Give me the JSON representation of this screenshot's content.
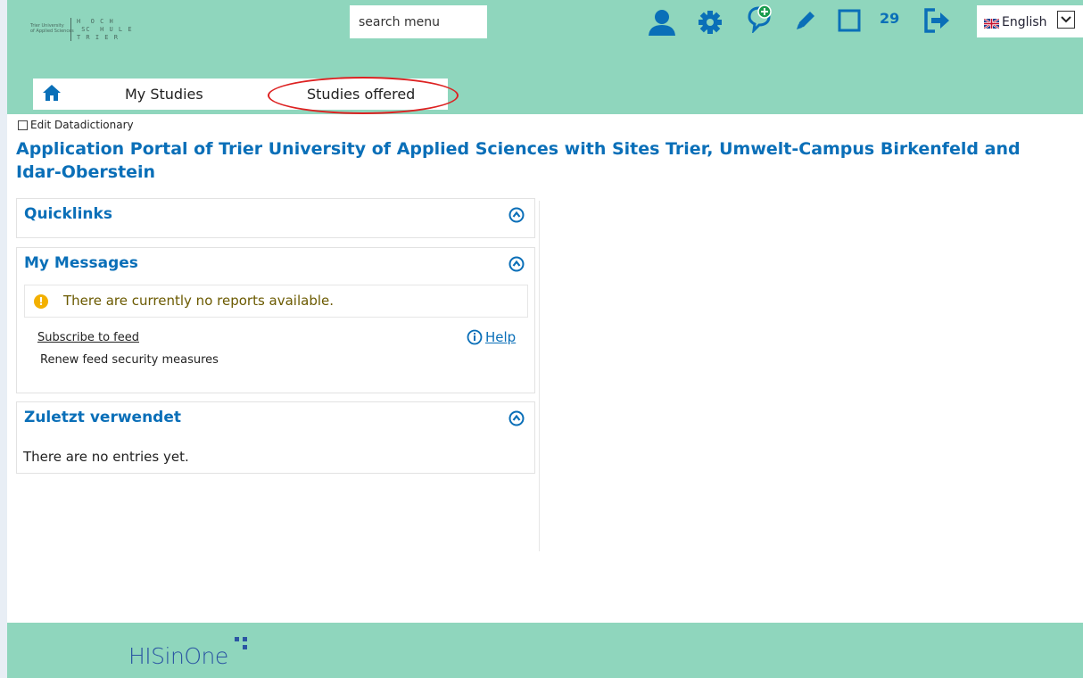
{
  "header": {
    "logo": {
      "small_text": "Trier University\nof Applied Sciences",
      "word_text": "H  O C H\n SC  H U L E\nT R I E R"
    },
    "search_placeholder": "search menu",
    "notification_count": "29",
    "language": {
      "label": "English",
      "flag": "uk-flag-icon"
    },
    "icons": [
      "user-icon",
      "gear-icon",
      "add-comment-icon",
      "pencil-icon",
      "square-icon",
      "logout-icon"
    ],
    "accent_color": "#0a6fb8",
    "bar_color": "#8fd6bd"
  },
  "tabs": [
    {
      "label": "My Studies"
    },
    {
      "label": "Studies offered"
    }
  ],
  "edit_datadictionary_label": "Edit Datadictionary",
  "page_title": "Application Portal of Trier University of Applied Sciences with Sites Trier, Umwelt-Campus Birkenfeld and Idar-Oberstein",
  "panels": {
    "quicklinks": {
      "title": "Quicklinks"
    },
    "messages": {
      "title": "My Messages",
      "info": "There are currently no reports available.",
      "subscribe_label": "Subscribe to feed",
      "help_label": "Help",
      "renew_label": "Renew feed security measures"
    },
    "recent": {
      "title": "Zuletzt verwendet",
      "empty_text": "There are no entries yet."
    }
  },
  "footer": {
    "brand": "HISinOne"
  }
}
